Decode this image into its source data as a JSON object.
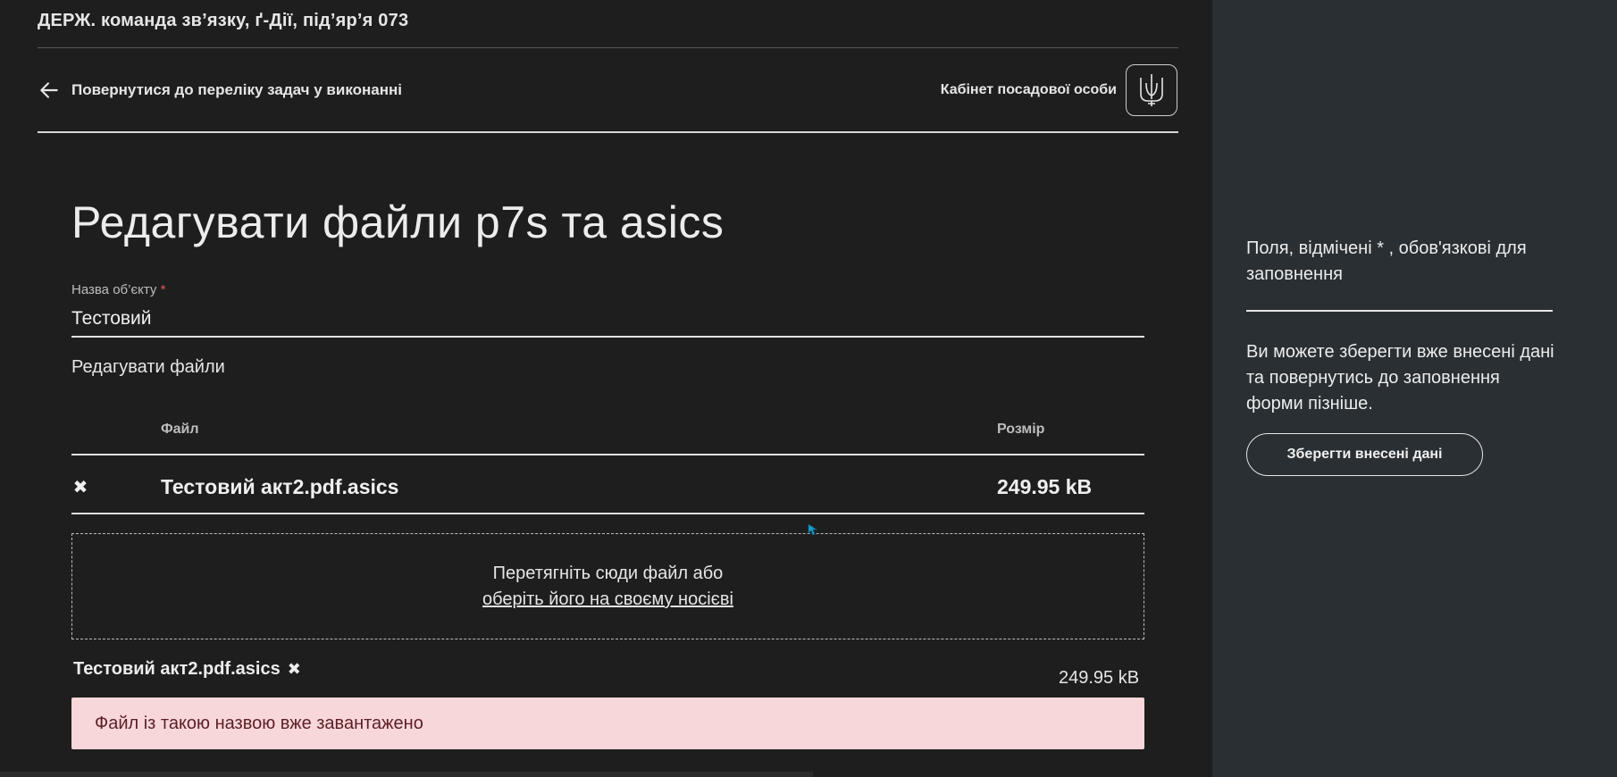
{
  "header": {
    "org_name": "ДЕРЖ. команда зв’язку, ґ-Дії, під’яр’я 073",
    "back_link": "Повернутися до переліку задач у виконанні",
    "cabinet_label": "Кабінет посадової особи",
    "emblem_icon": "trident-emblem-icon"
  },
  "form": {
    "title": "Редагувати файли p7s та asics",
    "object_name_label": "Назва об’єкту",
    "required_mark": "*",
    "object_name_value": "Тестовий",
    "files_section_label": "Редагувати файли",
    "table": {
      "col_file": "Файл",
      "col_size": "Розмір",
      "rows": [
        {
          "name": "Тестовий акт2.pdf.asics",
          "size": "249.95 kB"
        }
      ]
    },
    "dropzone": {
      "text": "Перетягніть сюди файл або",
      "link": "оберіть його на своєму носієві"
    },
    "uploaded": {
      "name": "Тестовий акт2.pdf.asics",
      "size": "249.95 kB"
    },
    "error_message": "Файл із такою назвою вже завантажено"
  },
  "sidebar": {
    "required_note": "Поля, відмічені * , обов'язкові для заповнення",
    "save_note": "Ви можете зберегти вже внесені дані та повернутись до заповнення форми пізніше.",
    "save_button": "Зберегти внесені дані"
  },
  "colors": {
    "background": "#1e1e1e",
    "sidebar": "#2a2f33",
    "alert_bg": "#f8d7da",
    "alert_text": "#5b1f26",
    "required": "#e0555e"
  }
}
